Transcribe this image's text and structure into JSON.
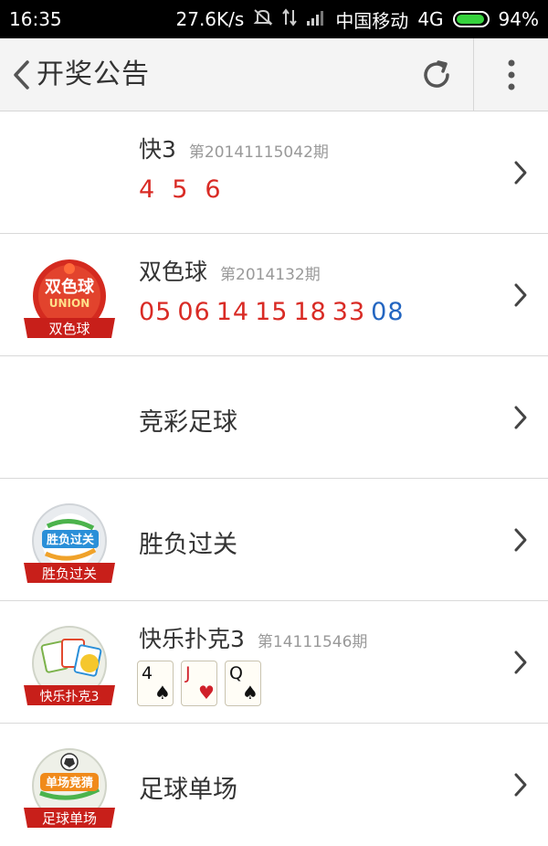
{
  "status_bar": {
    "time": "16:35",
    "speed": "27.6K/s",
    "carrier": "中国移动",
    "network": "4G",
    "battery": "94%",
    "battery_level": 0.94
  },
  "header": {
    "title": "开奖公告"
  },
  "lotteries": [
    {
      "name": "快3",
      "issue": "第20141115042期",
      "numbers": [
        "4",
        "5",
        "6"
      ]
    },
    {
      "name": "双色球",
      "issue": "第2014132期",
      "red": [
        "05",
        "06",
        "14",
        "15",
        "18",
        "33"
      ],
      "blue": [
        "08"
      ],
      "logo_text": "双色球",
      "logo_mark": "UNION"
    },
    {
      "name": "竞彩足球"
    },
    {
      "name": "胜负过关",
      "logo_text": "胜负过关",
      "logo_mark": "胜负过关"
    },
    {
      "name": "快乐扑克3",
      "issue": "第14111546期",
      "logo_text": "快乐扑克3",
      "cards": [
        {
          "rank": "4",
          "suit": "♠"
        },
        {
          "rank": "J",
          "suit": "♥"
        },
        {
          "rank": "Q",
          "suit": "♠"
        }
      ]
    },
    {
      "name": "足球单场",
      "logo_text": "足球单场",
      "logo_mark": "单场竞猜"
    }
  ]
}
